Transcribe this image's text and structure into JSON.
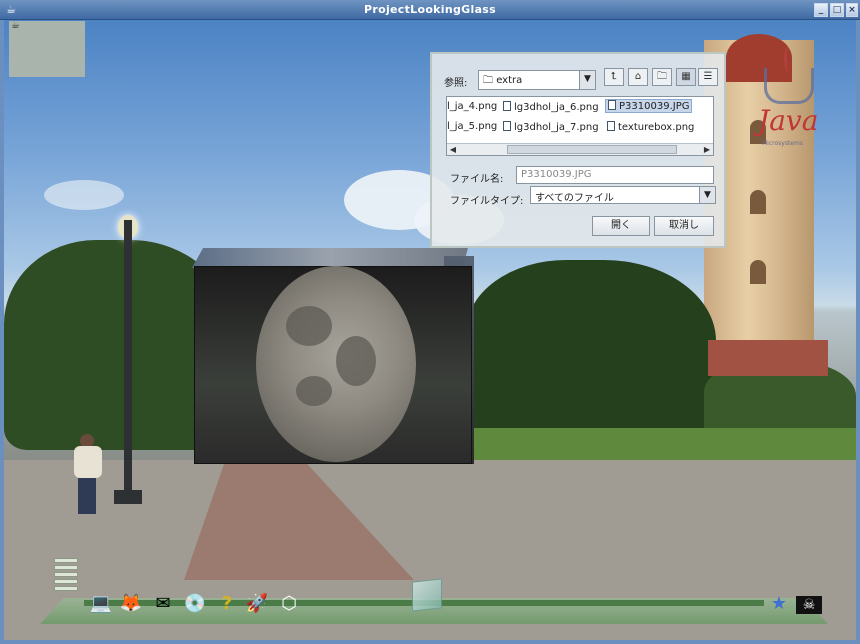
{
  "window": {
    "title": "ProjectLookingGlass",
    "controls": {
      "minimize": "_",
      "maximize": "□",
      "close": "×"
    }
  },
  "file_chooser": {
    "look_in_label": "参照:",
    "folder": "extra",
    "toolbar_icons": [
      "up-folder-icon",
      "home-icon",
      "new-folder-icon",
      "list-view-icon",
      "details-view-icon"
    ],
    "files": [
      {
        "name": "l_ja_4.png",
        "selected": false
      },
      {
        "name": "lg3dhol_ja_6.png",
        "selected": false
      },
      {
        "name": "P3310039.JPG",
        "selected": true
      },
      {
        "name": "l_ja_5.png",
        "selected": false
      },
      {
        "name": "lg3dhol_ja_7.png",
        "selected": false
      },
      {
        "name": "texturebox.png",
        "selected": false
      }
    ],
    "filename_label": "ファイル名:",
    "filename_value": "P3310039.JPG",
    "filetype_label": "ファイルタイプ:",
    "filetype_value": "すべてのファイル",
    "open_button": "開く",
    "cancel_button": "取消し"
  },
  "java_logo": {
    "text": "Java",
    "sub": "Microsystems"
  },
  "taskbar": {
    "items": [
      {
        "name": "computer-icon",
        "glyph": "💻"
      },
      {
        "name": "firefox-icon",
        "glyph": "🦊"
      },
      {
        "name": "mail-icon",
        "glyph": "✉"
      },
      {
        "name": "cd-icon",
        "glyph": "💿"
      },
      {
        "name": "help-icon",
        "glyph": "?"
      },
      {
        "name": "rocket-icon",
        "glyph": "🚀"
      },
      {
        "name": "cube-icon",
        "glyph": "⬡"
      }
    ],
    "right_items": [
      {
        "name": "star-icon",
        "glyph": "★"
      },
      {
        "name": "pirate-flag-icon",
        "glyph": "☠"
      }
    ]
  }
}
